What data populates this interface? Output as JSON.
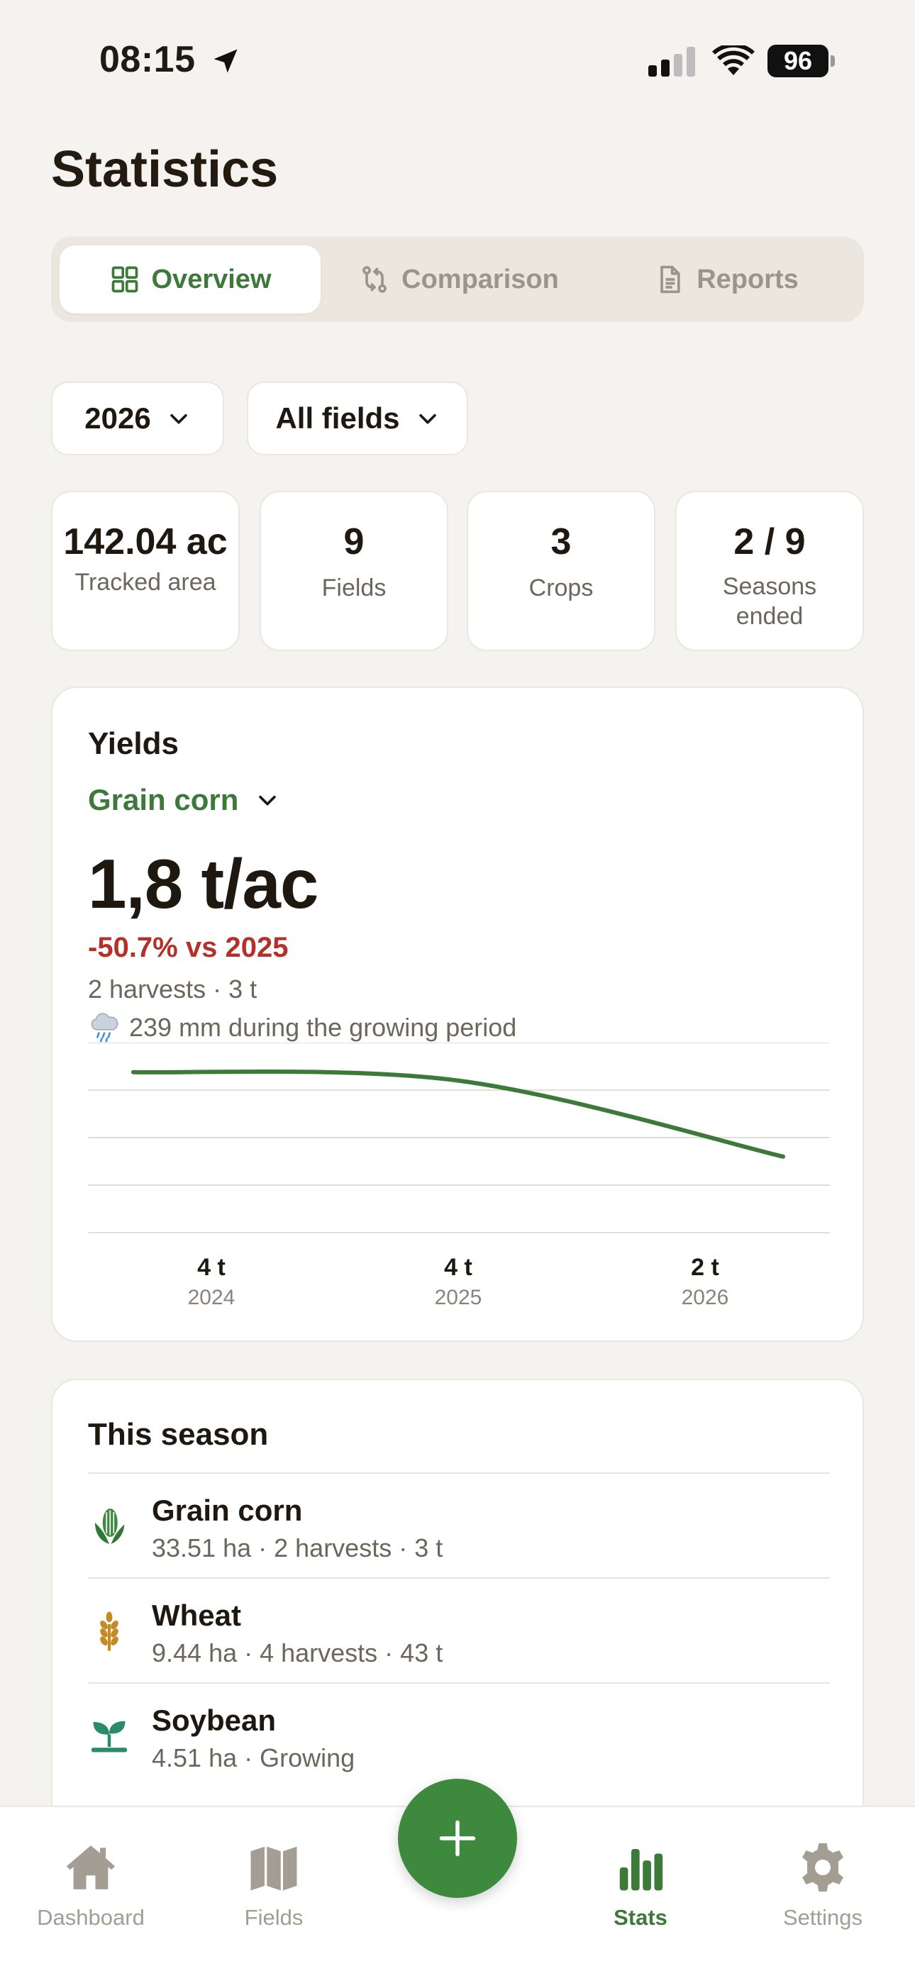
{
  "status_bar": {
    "time": "08:15",
    "battery": "96"
  },
  "page": {
    "title": "Statistics"
  },
  "tabs": [
    {
      "label": "Overview",
      "icon": "grid-icon",
      "active": true
    },
    {
      "label": "Comparison",
      "icon": "compare-icon",
      "active": false
    },
    {
      "label": "Reports",
      "icon": "document-icon",
      "active": false
    }
  ],
  "filters": {
    "year": "2026",
    "fields": "All fields"
  },
  "stats": [
    {
      "value": "142.04 ac",
      "label": "Tracked area"
    },
    {
      "value": "9",
      "label": "Fields"
    },
    {
      "value": "3",
      "label": "Crops"
    },
    {
      "value": "2 / 9",
      "label": "Seasons ended"
    }
  ],
  "yields": {
    "title": "Yields",
    "crop": "Grain corn",
    "value": "1,8 t/ac",
    "delta": "-50.7% vs 2025",
    "harvests": "2 harvests · 3 t",
    "rain": "239 mm during the growing period",
    "colors": {
      "line": "#3d7a3a",
      "delta": "#b3302b"
    }
  },
  "chart_data": {
    "type": "line",
    "categories": [
      "2024",
      "2025",
      "2026"
    ],
    "value_labels": [
      "4 t",
      "4 t",
      "2 t"
    ],
    "series": [
      {
        "values": [
          3.8,
          3.6,
          1.8
        ]
      }
    ],
    "ylim": [
      0,
      4.5
    ],
    "grid": true
  },
  "season": {
    "title": "This season",
    "items": [
      {
        "name": "Grain corn",
        "meta": "33.51 ha · 2 harvests · 3 t",
        "icon": "corn-icon"
      },
      {
        "name": "Wheat",
        "meta": "9.44 ha · 4 harvests · 43 t",
        "icon": "wheat-icon"
      },
      {
        "name": "Soybean",
        "meta": "4.51 ha · Growing",
        "icon": "sprout-icon"
      }
    ]
  },
  "nav": {
    "dashboard": "Dashboard",
    "fields": "Fields",
    "stats": "Stats",
    "settings": "Settings"
  }
}
